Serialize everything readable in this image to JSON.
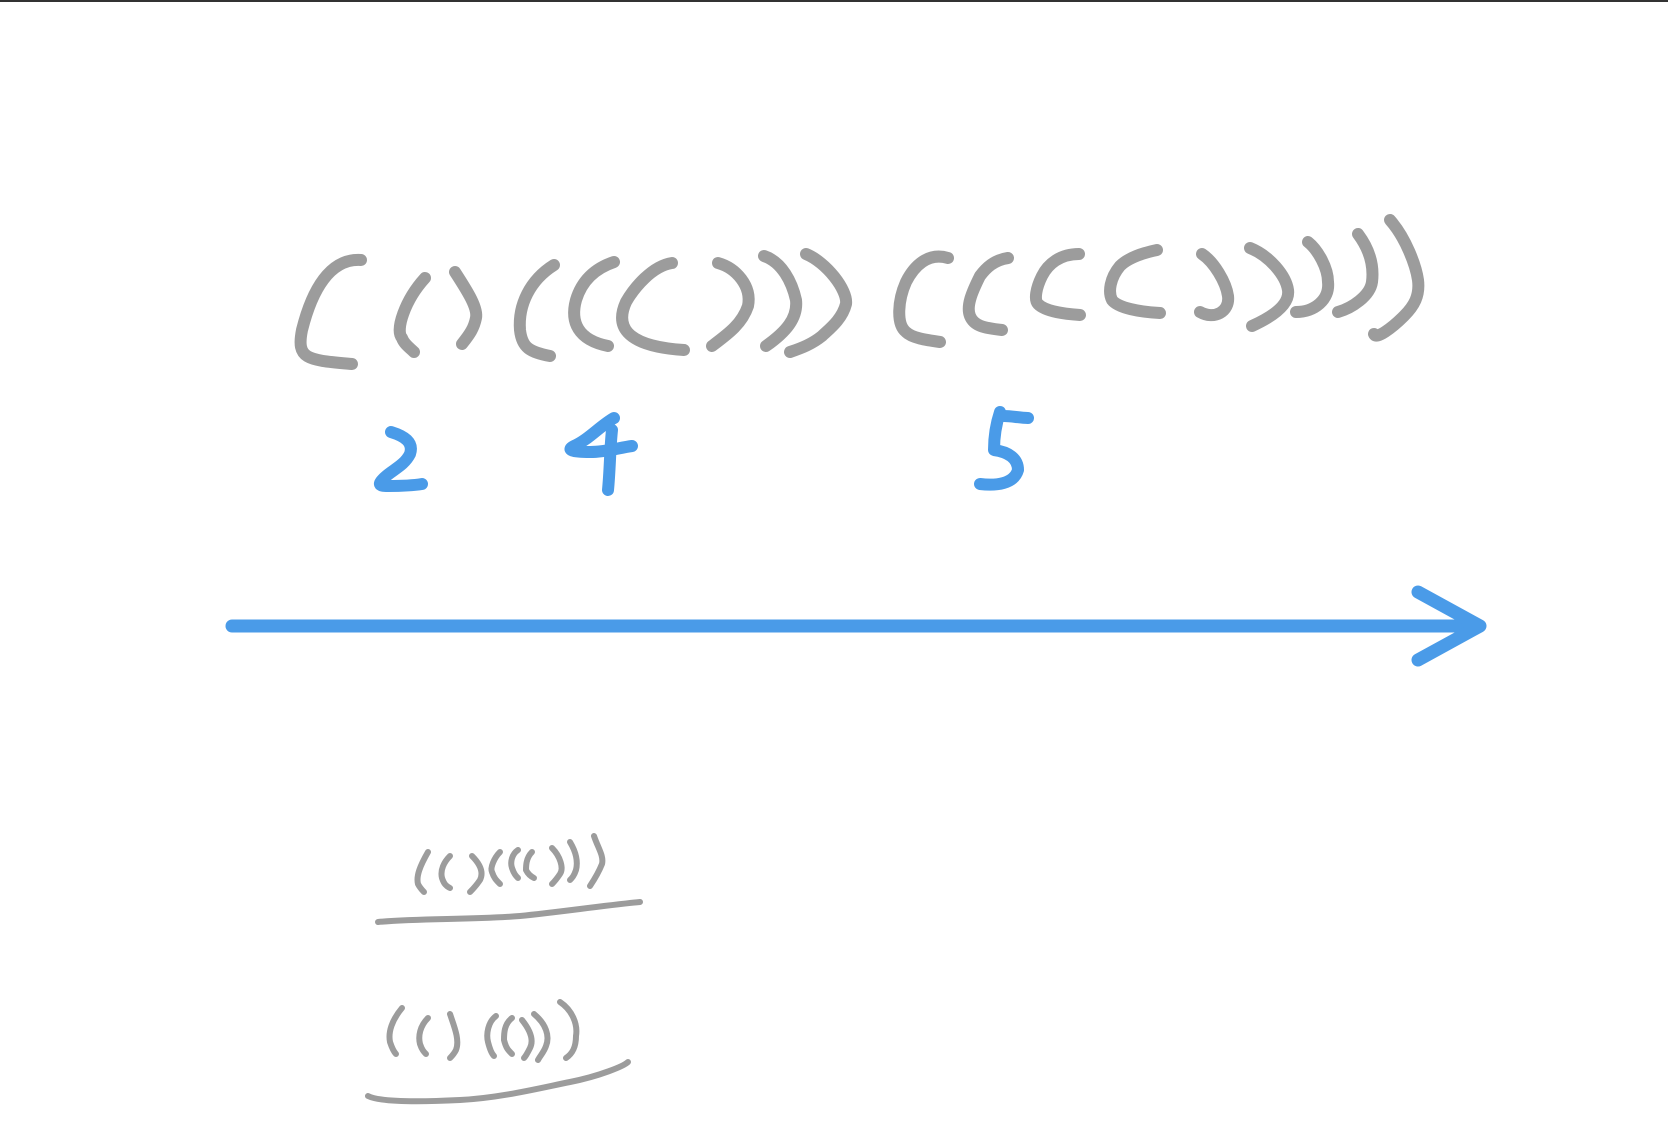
{
  "sketch": {
    "ink_colors": {
      "parentheses": "#9c9c9c",
      "annotations": "#4a9be8"
    },
    "main_sequence": {
      "text": "(()((()))((((()))))",
      "depth_labels": [
        "2",
        "4",
        "5"
      ]
    },
    "arrow": {
      "direction": "right",
      "icon": "right-arrow-icon"
    },
    "examples": [
      {
        "text": "(()((())))",
        "underline": "gray"
      },
      {
        "text": "(()(())))",
        "underline": "gray"
      }
    ]
  }
}
